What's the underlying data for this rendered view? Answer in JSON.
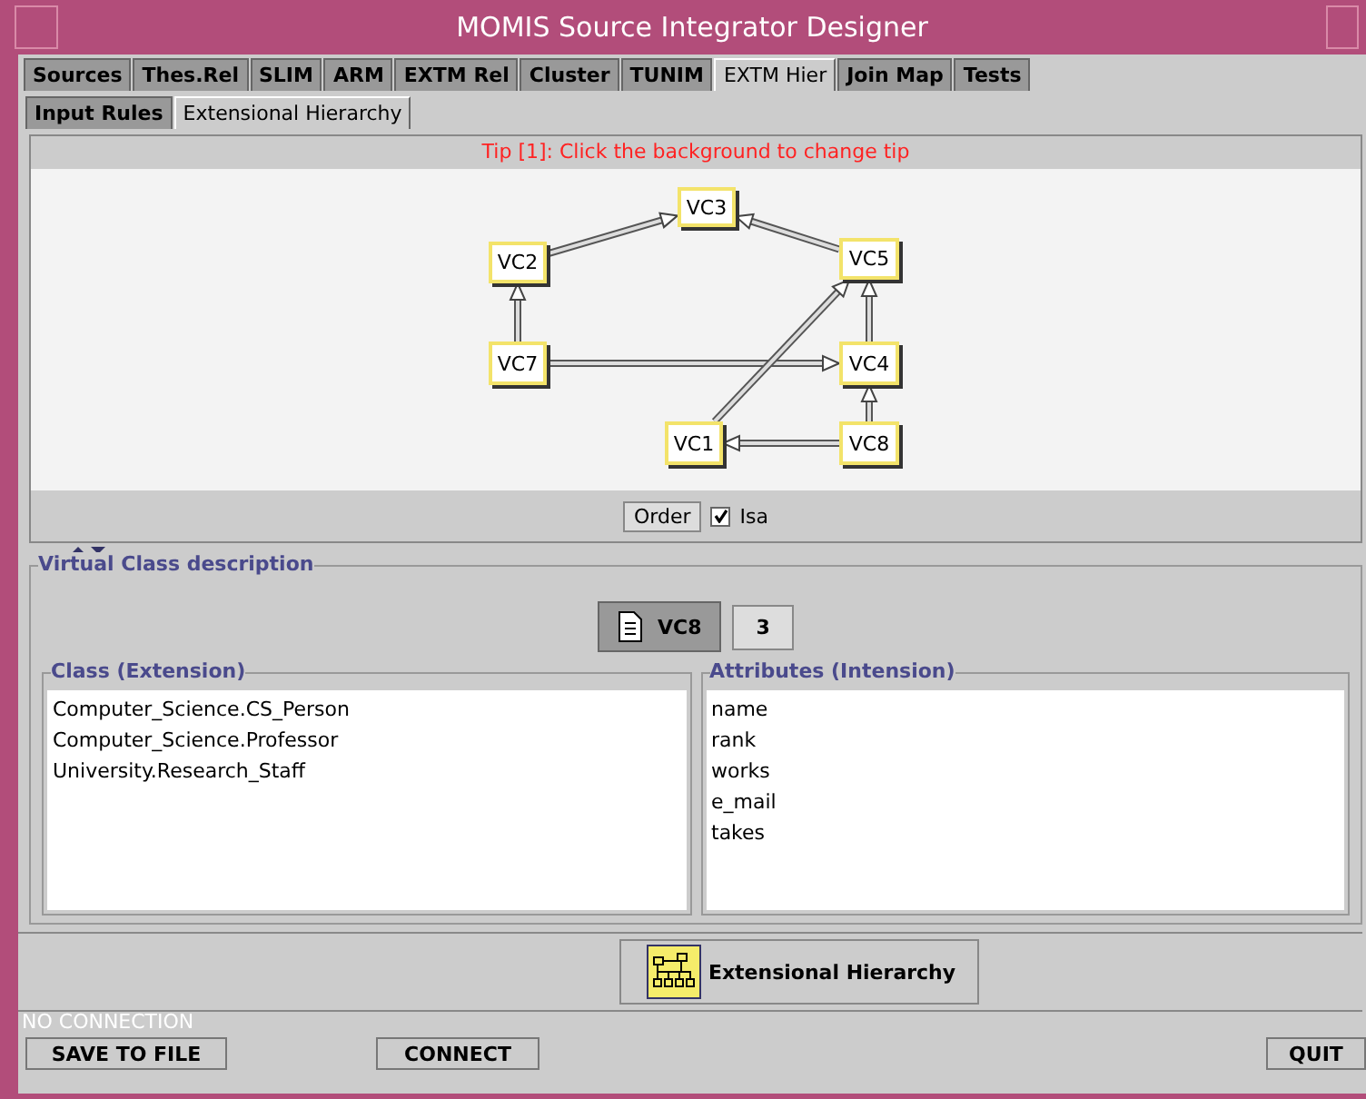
{
  "window": {
    "title": "MOMIS Source Integrator Designer"
  },
  "tabs": [
    {
      "label": "Sources",
      "selected": false
    },
    {
      "label": "Thes.Rel",
      "selected": false
    },
    {
      "label": "SLIM",
      "selected": false
    },
    {
      "label": "ARM",
      "selected": false
    },
    {
      "label": "EXTM Rel",
      "selected": false
    },
    {
      "label": "Cluster",
      "selected": false
    },
    {
      "label": "TUNIM",
      "selected": false
    },
    {
      "label": "EXTM Hier",
      "selected": true
    },
    {
      "label": "Join Map",
      "selected": false
    },
    {
      "label": "Tests",
      "selected": false
    }
  ],
  "subtabs": [
    {
      "label": "Input Rules",
      "selected": false
    },
    {
      "label": "Extensional Hierarchy",
      "selected": true
    }
  ],
  "graph": {
    "tip": "Tip [1]: Click the background to change tip",
    "nodes": [
      {
        "label": "VC3"
      },
      {
        "label": "VC2"
      },
      {
        "label": "VC5"
      },
      {
        "label": "VC7"
      },
      {
        "label": "VC4"
      },
      {
        "label": "VC1"
      },
      {
        "label": "VC8"
      }
    ],
    "order_button": "Order",
    "isa": {
      "label": "Isa",
      "checked": true
    }
  },
  "description": {
    "title": "Virtual Class description",
    "class_name": "VC8",
    "count": "3",
    "extension": {
      "title": "Class (Extension)",
      "items": [
        "Computer_Science.CS_Person",
        "Computer_Science.Professor",
        "University.Research_Staff"
      ]
    },
    "intension": {
      "title": "Attributes (Intension)",
      "items": [
        "name",
        "rank",
        "works",
        "e_mail",
        "takes"
      ]
    }
  },
  "hierarchy_button": "Extensional Hierarchy",
  "status": "NO CONNECTION",
  "buttons": [
    {
      "label": "SAVE TO FILE"
    },
    {
      "label": "CONNECT"
    },
    {
      "label": "QUIT"
    }
  ]
}
